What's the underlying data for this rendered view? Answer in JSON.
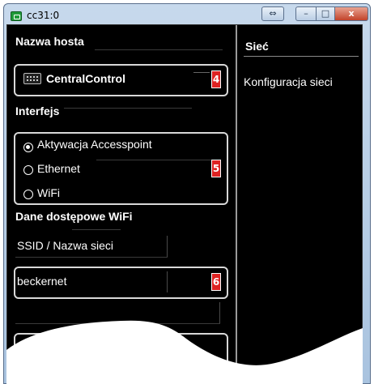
{
  "window": {
    "title": "cc31:0",
    "controls": {
      "resize_glyph": "⇔",
      "minimize_glyph": "–",
      "maximize_glyph": "□",
      "close_glyph": "x"
    }
  },
  "left": {
    "hostname": {
      "label": "Nazwa hosta",
      "value": "CentralControl",
      "badge": "4",
      "icon": "keyboard-icon"
    },
    "interface": {
      "label": "Interfejs",
      "badge": "5",
      "options": [
        {
          "label": "Aktywacja Accesspoint",
          "checked": true
        },
        {
          "label": "Ethernet",
          "checked": false
        },
        {
          "label": "WiFi",
          "checked": false
        }
      ]
    },
    "wifi": {
      "label": "Dane dostępowe WiFi",
      "ssid_label": "SSID / Nazwa sieci",
      "ssid_value": "beckernet",
      "badge": "6"
    }
  },
  "right": {
    "title": "Sieć",
    "link": "Konfiguracja sieci"
  },
  "colors": {
    "content_bg": "#000000",
    "badge_red": "#dd2222",
    "titlebar": "#b9cfe7"
  }
}
